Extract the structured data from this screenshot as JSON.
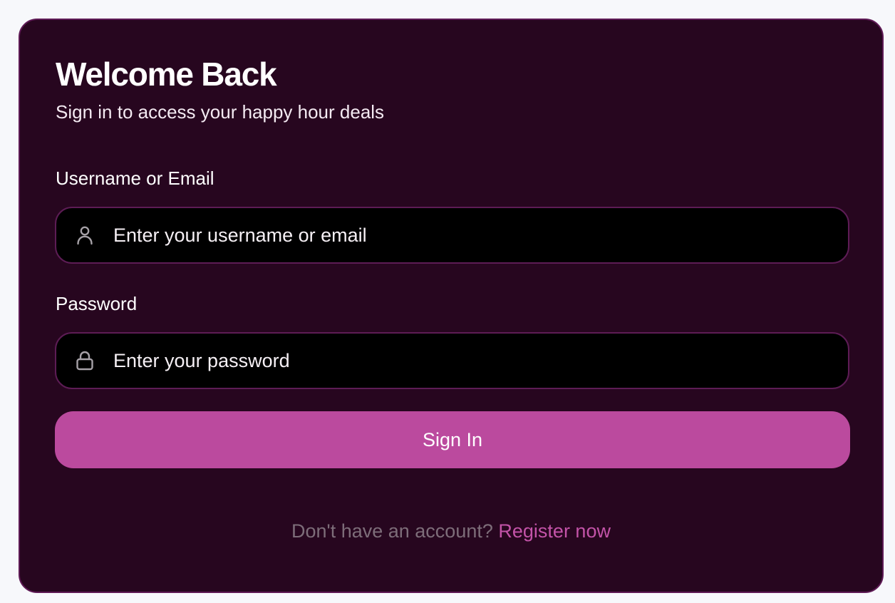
{
  "login": {
    "title": "Welcome Back",
    "subtitle": "Sign in to access your happy hour deals",
    "username": {
      "label": "Username or Email",
      "placeholder": "Enter your username or email",
      "value": "",
      "icon": "user-icon"
    },
    "password": {
      "label": "Password",
      "placeholder": "Enter your password",
      "value": "",
      "icon": "lock-icon"
    },
    "submit_label": "Sign In",
    "footer": {
      "prompt": "Don't have an account?",
      "link_label": "Register now"
    }
  },
  "colors": {
    "page_background": "#f7f8fb",
    "card_background": "#27061f",
    "card_border": "#5e1a55",
    "input_background": "#000000",
    "accent": "#bb4a9e",
    "muted_text": "#7d6d79"
  }
}
